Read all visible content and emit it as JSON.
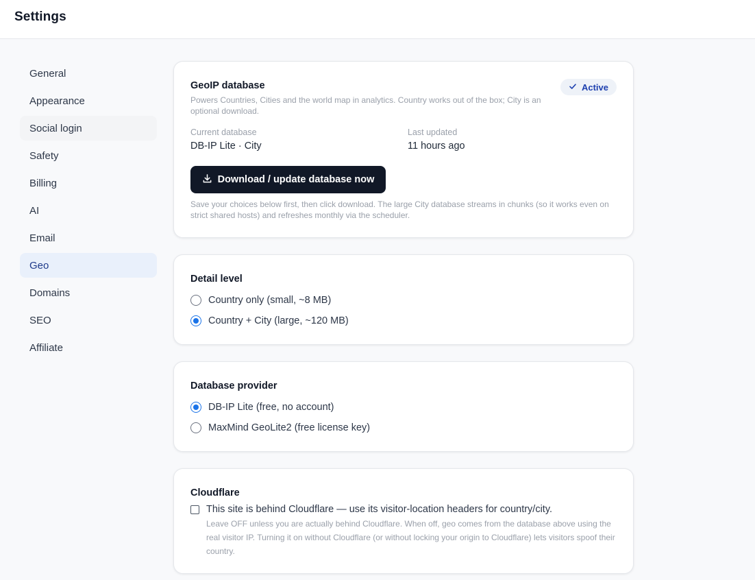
{
  "header": {
    "title": "Settings"
  },
  "sidebar": {
    "items": [
      {
        "label": "General"
      },
      {
        "label": "Appearance"
      },
      {
        "label": "Social login"
      },
      {
        "label": "Safety"
      },
      {
        "label": "Billing"
      },
      {
        "label": "AI"
      },
      {
        "label": "Email"
      },
      {
        "label": "Geo"
      },
      {
        "label": "Domains"
      },
      {
        "label": "SEO"
      },
      {
        "label": "Affiliate"
      }
    ],
    "active": "Geo"
  },
  "geoip": {
    "title": "GeoIP database",
    "description": "Powers Countries, Cities and the world map in analytics. Country works out of the box; City is an optional download.",
    "status_badge": "Active",
    "current_database_label": "Current database",
    "current_database_value": "DB-IP Lite · City",
    "last_updated_label": "Last updated",
    "last_updated_value": "11 hours ago",
    "download_button": "Download / update database now",
    "note": "Save your choices below first, then click download. The large City database streams in chunks (so it works even on strict shared hosts) and refreshes monthly via the scheduler."
  },
  "detail_level": {
    "title": "Detail level",
    "options": [
      {
        "label": "Country only (small, ~8 MB)",
        "checked": false
      },
      {
        "label": "Country + City (large, ~120 MB)",
        "checked": true
      }
    ]
  },
  "provider": {
    "title": "Database provider",
    "options": [
      {
        "label": "DB-IP Lite (free, no account)",
        "checked": true
      },
      {
        "label": "MaxMind GeoLite2 (free license key)",
        "checked": false
      }
    ]
  },
  "cloudflare": {
    "title": "Cloudflare",
    "checkbox_label": "This site is behind Cloudflare — use its visitor-location headers for country/city.",
    "checked": false,
    "note": "Leave OFF unless you are actually behind Cloudflare. When off, geo comes from the database above using the real visitor IP. Turning it on without Cloudflare (or without locking your origin to Cloudflare) lets visitors spoof their country."
  },
  "colors": {
    "accent": "#1a73e8",
    "button_dark": "#111827",
    "active_nav_bg": "#e9f0fb",
    "badge_bg": "#eef2f8",
    "badge_text": "#1e40af"
  }
}
